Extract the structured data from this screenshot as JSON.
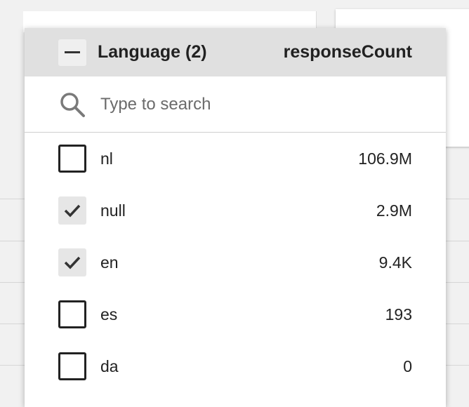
{
  "header": {
    "title": "Language (2)",
    "metric": "responseCount"
  },
  "search": {
    "placeholder": "Type to search"
  },
  "items": [
    {
      "label": "nl",
      "value": "106.9M",
      "checked": false
    },
    {
      "label": "null",
      "value": "2.9M",
      "checked": true
    },
    {
      "label": "en",
      "value": "9.4K",
      "checked": true
    },
    {
      "label": "es",
      "value": "193",
      "checked": false
    },
    {
      "label": "da",
      "value": "0",
      "checked": false
    }
  ],
  "icons": {
    "collapse": "minus-icon",
    "search": "search-icon",
    "check": "check-icon"
  },
  "colors": {
    "header_bg": "#e0e0e0",
    "text": "#222222"
  }
}
